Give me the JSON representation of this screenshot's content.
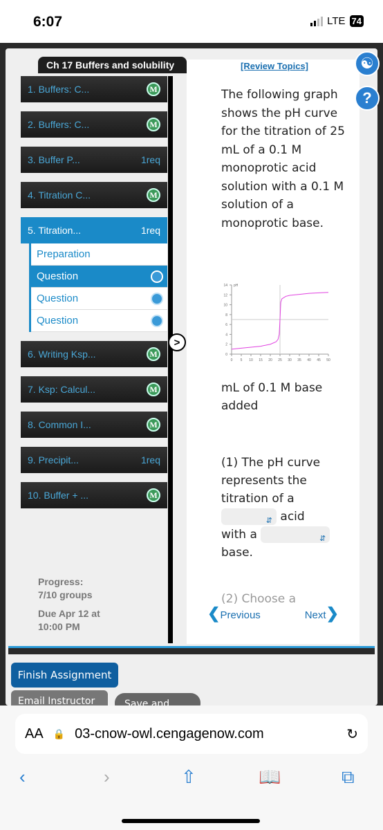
{
  "status": {
    "time": "6:07",
    "network": "LTE",
    "battery": "74"
  },
  "chapter_title": "Ch 17 Buffers and solubility",
  "sidebar": {
    "items": [
      {
        "label": "1. Buffers: C...",
        "badge": "M"
      },
      {
        "label": "2. Buffers: C...",
        "badge": "M"
      },
      {
        "label": "3. Buffer P...",
        "badge": "1req"
      },
      {
        "label": "4. Titration C...",
        "badge": "M"
      },
      {
        "label": "5. Titration...",
        "badge": "1req"
      },
      {
        "label": "6. Writing Ksp...",
        "badge": "M"
      },
      {
        "label": "7. Ksp: Calcul...",
        "badge": "M"
      },
      {
        "label": "8. Common I...",
        "badge": "M"
      },
      {
        "label": "9. Precipit...",
        "badge": "1req"
      },
      {
        "label": "10. Buffer + ...",
        "badge": "M"
      }
    ],
    "subitems": [
      {
        "label": "Preparation"
      },
      {
        "label": "Question"
      },
      {
        "label": "Question"
      },
      {
        "label": "Question"
      }
    ]
  },
  "progress": {
    "label": "Progress:",
    "value": "7/10 groups",
    "due": "Due Apr 12 at",
    "due_time": "10:00 PM"
  },
  "content": {
    "review": "[Review Topics]",
    "question": "The following graph shows the pH curve for the titration of 25 mL of a 0.1 M monoprotic acid solution with a 0.1 M solution of a monoprotic base.",
    "xlabel": "mL of 0.1 M base added",
    "q1_prefix": "(1) The pH curve represents the titration of a",
    "q1_acid": "acid",
    "q1_with": "with a",
    "q1_base": "base.",
    "q2": "(2) Choose a",
    "prev": "Previous",
    "next": "Next"
  },
  "chart_data": {
    "type": "line",
    "ylabel": "pH",
    "xlabel": "mL of 0.1 M base added",
    "xlim": [
      0,
      50
    ],
    "ylim": [
      0,
      14
    ],
    "xticks": [
      0,
      5,
      10,
      15,
      20,
      25,
      30,
      35,
      40,
      45,
      50
    ],
    "yticks": [
      0,
      2,
      4,
      6,
      8,
      10,
      12,
      14
    ],
    "reference_lines": {
      "x": 25,
      "y": 7
    },
    "color": "#e040e0",
    "x": [
      0,
      5,
      10,
      15,
      20,
      23,
      24,
      24.6,
      25,
      25.4,
      26,
      28,
      30,
      35,
      40,
      45,
      50
    ],
    "y": [
      1.0,
      1.2,
      1.4,
      1.6,
      2.0,
      2.5,
      3.0,
      4.0,
      7.0,
      10.5,
      11.2,
      11.7,
      11.9,
      12.1,
      12.3,
      12.4,
      12.5
    ]
  },
  "buttons": {
    "finish": "Finish Assignment",
    "email": "Email Instructor",
    "save": "Save and Exit"
  },
  "browser": {
    "aa": "AA",
    "url": "03-cnow-owl.cengagenow.com"
  },
  "colors": {
    "accent": "#1a8ac8",
    "finish": "#0f5fa0"
  }
}
